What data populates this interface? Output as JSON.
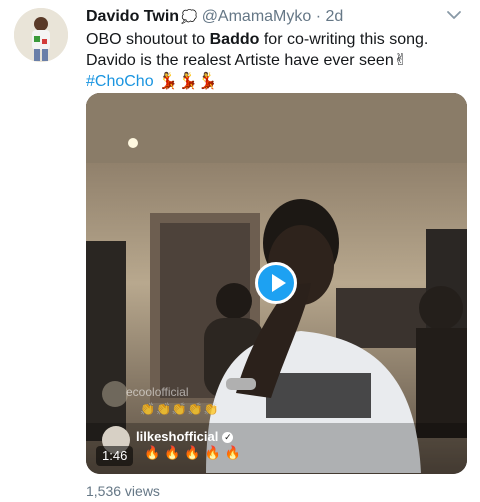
{
  "tweet": {
    "display_name": "Davido Twin",
    "badge_glyph": "💭",
    "handle": "@AmamaMyko",
    "separator": "·",
    "timestamp": "2d",
    "text_part1": "OBO shoutout to ",
    "text_bold": "Baddo",
    "text_part2": " for co-writing this song. Davido is the realest Artiste have ever seen✌ ",
    "hashtag": "#ChoCho",
    "text_emojis": " 💃💃💃",
    "views": "1,536 views"
  },
  "video": {
    "duration": "1:46",
    "overlay_comment_user_faded": "ecoolofficial",
    "overlay_comment_faded_emojis": "👏👏👏👏👏",
    "overlay_comment_user": "lilkeshofficial",
    "overlay_comment_emojis": "🔥🔥🔥🔥🔥"
  },
  "colors": {
    "accent": "#1da1f2",
    "hashtag": "#1b95e0",
    "muted": "#657786"
  },
  "icons": {
    "more": "chevron-down-icon",
    "play": "play-icon",
    "verified": "verified-icon"
  }
}
